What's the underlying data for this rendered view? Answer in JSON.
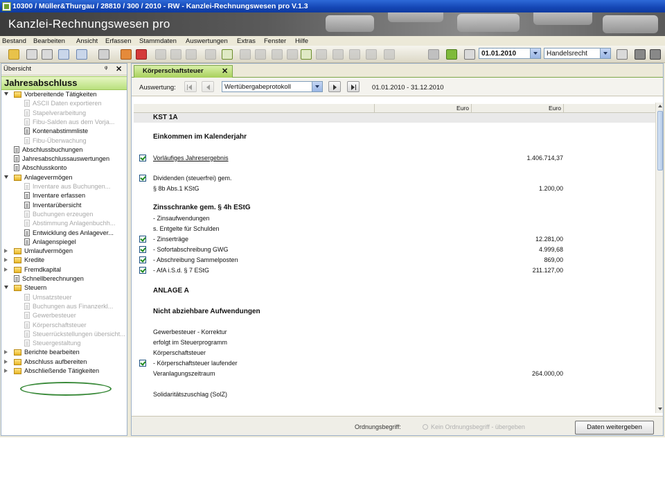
{
  "window": {
    "title": "10300 / Müller&Thurgau / 28810 / 300 / 2010 - RW - Kanzlei-Rechnungswesen pro V.1.3"
  },
  "banner": {
    "title": "Kanzlei-Rechnungswesen pro"
  },
  "menu": [
    "Bestand",
    "Bearbeiten",
    "Ansicht",
    "Erfassen",
    "Stammdaten",
    "Auswertungen",
    "Extras",
    "Fenster",
    "Hilfe"
  ],
  "toolbar": {
    "date": "01.01.2010",
    "mode": "Handelsrecht"
  },
  "sidebar": {
    "header": "Übersicht",
    "pin": "ᵠ",
    "close": "✕",
    "section": "Jahresabschluss",
    "items": [
      {
        "label": "Vorbereitende Tätigkeiten",
        "type": "folder",
        "expand": "open",
        "dim": false
      },
      {
        "label": "ASCII Daten exportieren",
        "type": "doc",
        "dim": true
      },
      {
        "label": "Stapelverarbeitung",
        "type": "doc",
        "dim": true
      },
      {
        "label": "Fibu-Salden aus dem Vorja...",
        "type": "doc",
        "dim": true
      },
      {
        "label": "Kontenabstimmliste",
        "type": "doc",
        "dim": false
      },
      {
        "label": "Fibu-Überwachung",
        "type": "doc",
        "dim": true
      },
      {
        "label": "Abschlussbuchungen",
        "type": "doc",
        "dim": false
      },
      {
        "label": "Jahresabschlussauswertungen",
        "type": "doc",
        "dim": false
      },
      {
        "label": "Abschlusskonto",
        "type": "doc",
        "dim": false
      },
      {
        "label": "Anlagevermögen",
        "type": "folder",
        "expand": "open",
        "dim": false
      },
      {
        "label": "Inventare aus Buchungen...",
        "type": "doc",
        "dim": true
      },
      {
        "label": "Inventare erfassen",
        "type": "doc",
        "dim": false
      },
      {
        "label": "Inventarübersicht",
        "type": "doc",
        "dim": false
      },
      {
        "label": "Buchungen erzeugen",
        "type": "doc",
        "dim": true
      },
      {
        "label": "Abstimmung Anlagenbuchh...",
        "type": "doc",
        "dim": true
      },
      {
        "label": "Entwicklung des Anlagever...",
        "type": "doc",
        "dim": false
      },
      {
        "label": "Anlagenspiegel",
        "type": "doc",
        "dim": false
      },
      {
        "label": "Umlaufvermögen",
        "type": "folder",
        "expand": "closed",
        "dim": false
      },
      {
        "label": "Kredite",
        "type": "folder",
        "expand": "closed",
        "dim": false
      },
      {
        "label": "Fremdkapital",
        "type": "folder",
        "expand": "closed",
        "dim": false
      },
      {
        "label": "Schnellberechnungen",
        "type": "doc",
        "dim": false
      },
      {
        "label": "Steuern",
        "type": "folder",
        "expand": "open",
        "dim": false
      },
      {
        "label": "Umsatzsteuer",
        "type": "doc",
        "dim": true
      },
      {
        "label": "Buchungen aus Finanzerkl...",
        "type": "doc",
        "dim": true
      },
      {
        "label": "Gewerbesteuer",
        "type": "doc",
        "dim": true
      },
      {
        "label": "Körperschaftsteuer",
        "type": "doc",
        "dim": true
      },
      {
        "label": "Steuerrückstellungen übersicht...",
        "type": "doc",
        "dim": true
      },
      {
        "label": "Steuergestaltung",
        "type": "doc",
        "dim": true
      },
      {
        "label": "Berichte bearbeiten",
        "type": "folder",
        "expand": "closed",
        "dim": false
      },
      {
        "label": "Abschluss aufbereiten",
        "type": "folder",
        "expand": "closed",
        "dim": false
      },
      {
        "label": "Abschließende Tätigkeiten",
        "type": "folder",
        "expand": "closed",
        "dim": false
      }
    ]
  },
  "main": {
    "tab": "Körperschaftsteuer",
    "tab_close": "✕",
    "auswertung_label": "Auswertung:",
    "auswertung_value": "Wertübergabeprotokoll",
    "daterange": "01.01.2010 - 31.12.2010",
    "col1": "Euro",
    "col2": "Euro",
    "rows": [
      {
        "label": "KST 1A",
        "kind": "head",
        "band": true
      },
      {
        "label": "Einkommen im Kalenderjahr",
        "kind": "head"
      },
      {
        "label": "Vorläufiges Jahresergebnis",
        "check": true,
        "underline": true,
        "value": "1.406.714,37"
      },
      {
        "label": "Dividenden (steuerfrei) gem.",
        "check": true
      },
      {
        "label": "§ 8b Abs.1 KStG",
        "value": "1.200,00"
      },
      {
        "label": "Zinsschranke gem. § 4h EStG",
        "kind": "head"
      },
      {
        "label": "- Zinsaufwendungen"
      },
      {
        "label": "s. Entgelte für Schulden"
      },
      {
        "label": "- Zinserträge",
        "check": true,
        "value": "12.281,00"
      },
      {
        "label": "- Sofortabschreibung GWG",
        "check": true,
        "value": "4.999,68"
      },
      {
        "label": "- Abschreibung Sammelposten",
        "check": true,
        "value": "869,00"
      },
      {
        "label": "- AfA i.S.d. § 7 EStG",
        "check": true,
        "value": "211.127,00"
      },
      {
        "label": "ANLAGE A",
        "kind": "head"
      },
      {
        "label": "Nicht abziehbare Aufwendungen",
        "kind": "head"
      },
      {
        "label": "Gewerbesteuer - Korrektur"
      },
      {
        "label": "erfolgt im Steuerprogramm"
      },
      {
        "label": "Körperschaftsteuer"
      },
      {
        "label": "- Körperschaftsteuer laufender",
        "check": true
      },
      {
        "label": "Veranlagungszeitraum",
        "value": "264.000,00"
      },
      {
        "label": "Solidaritätszuschlag (SolZ)"
      }
    ]
  },
  "footer": {
    "ordnung_label": "Ordnungsbegriff:",
    "ordnung_text": "Kein Ordnungsbegriff - übergeben",
    "button": "Daten weitergeben"
  }
}
